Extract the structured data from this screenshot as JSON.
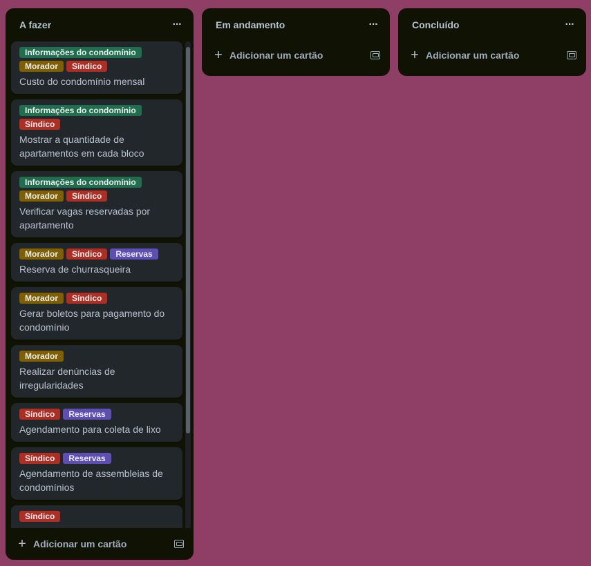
{
  "colors": {
    "board_bg": "#8f3f65",
    "list_bg": "#101204",
    "card_bg": "#22272b",
    "label_green": "#216e4e",
    "label_yellow": "#7f5f01",
    "label_red": "#ae2e24",
    "label_purple": "#5e4db2"
  },
  "lists": [
    {
      "title": "A fazer",
      "menu_icon": "ellipsis-icon",
      "add_card_label": "Adicionar um cartão",
      "cards": [
        {
          "labels": [
            {
              "text": "Informações do condomínio",
              "color": "green"
            },
            {
              "text": "Morador",
              "color": "yellow"
            },
            {
              "text": "Síndico",
              "color": "red"
            }
          ],
          "title": "Custo do condomínio mensal"
        },
        {
          "labels": [
            {
              "text": "Informações do condomínio",
              "color": "green"
            },
            {
              "text": "Síndico",
              "color": "red"
            }
          ],
          "title": "Mostrar a quantidade de apartamentos em cada bloco"
        },
        {
          "labels": [
            {
              "text": "Informações do condomínio",
              "color": "green"
            },
            {
              "text": "Morador",
              "color": "yellow"
            },
            {
              "text": "Síndico",
              "color": "red"
            }
          ],
          "title": "Verificar vagas reservadas por apartamento"
        },
        {
          "labels": [
            {
              "text": "Morador",
              "color": "yellow"
            },
            {
              "text": "Síndico",
              "color": "red"
            },
            {
              "text": "Reservas",
              "color": "purple"
            }
          ],
          "title": "Reserva de churrasqueira"
        },
        {
          "labels": [
            {
              "text": "Morador",
              "color": "yellow"
            },
            {
              "text": "Síndico",
              "color": "red"
            }
          ],
          "title": "Gerar boletos para pagamento do condomínio"
        },
        {
          "labels": [
            {
              "text": "Morador",
              "color": "yellow"
            }
          ],
          "title": "Realizar denúncias de irregularidades"
        },
        {
          "labels": [
            {
              "text": "Síndico",
              "color": "red"
            },
            {
              "text": "Reservas",
              "color": "purple"
            }
          ],
          "title": "Agendamento para coleta de lixo"
        },
        {
          "labels": [
            {
              "text": "Síndico",
              "color": "red"
            },
            {
              "text": "Reservas",
              "color": "purple"
            }
          ],
          "title": "Agendamento de assembleias de condomínios"
        },
        {
          "labels": [
            {
              "text": "Síndico",
              "color": "red"
            }
          ],
          "title": ""
        }
      ]
    },
    {
      "title": "Em andamento",
      "menu_icon": "ellipsis-icon",
      "add_card_label": "Adicionar um cartão",
      "cards": []
    },
    {
      "title": "Concluído",
      "menu_icon": "ellipsis-icon",
      "add_card_label": "Adicionar um cartão",
      "cards": []
    }
  ]
}
